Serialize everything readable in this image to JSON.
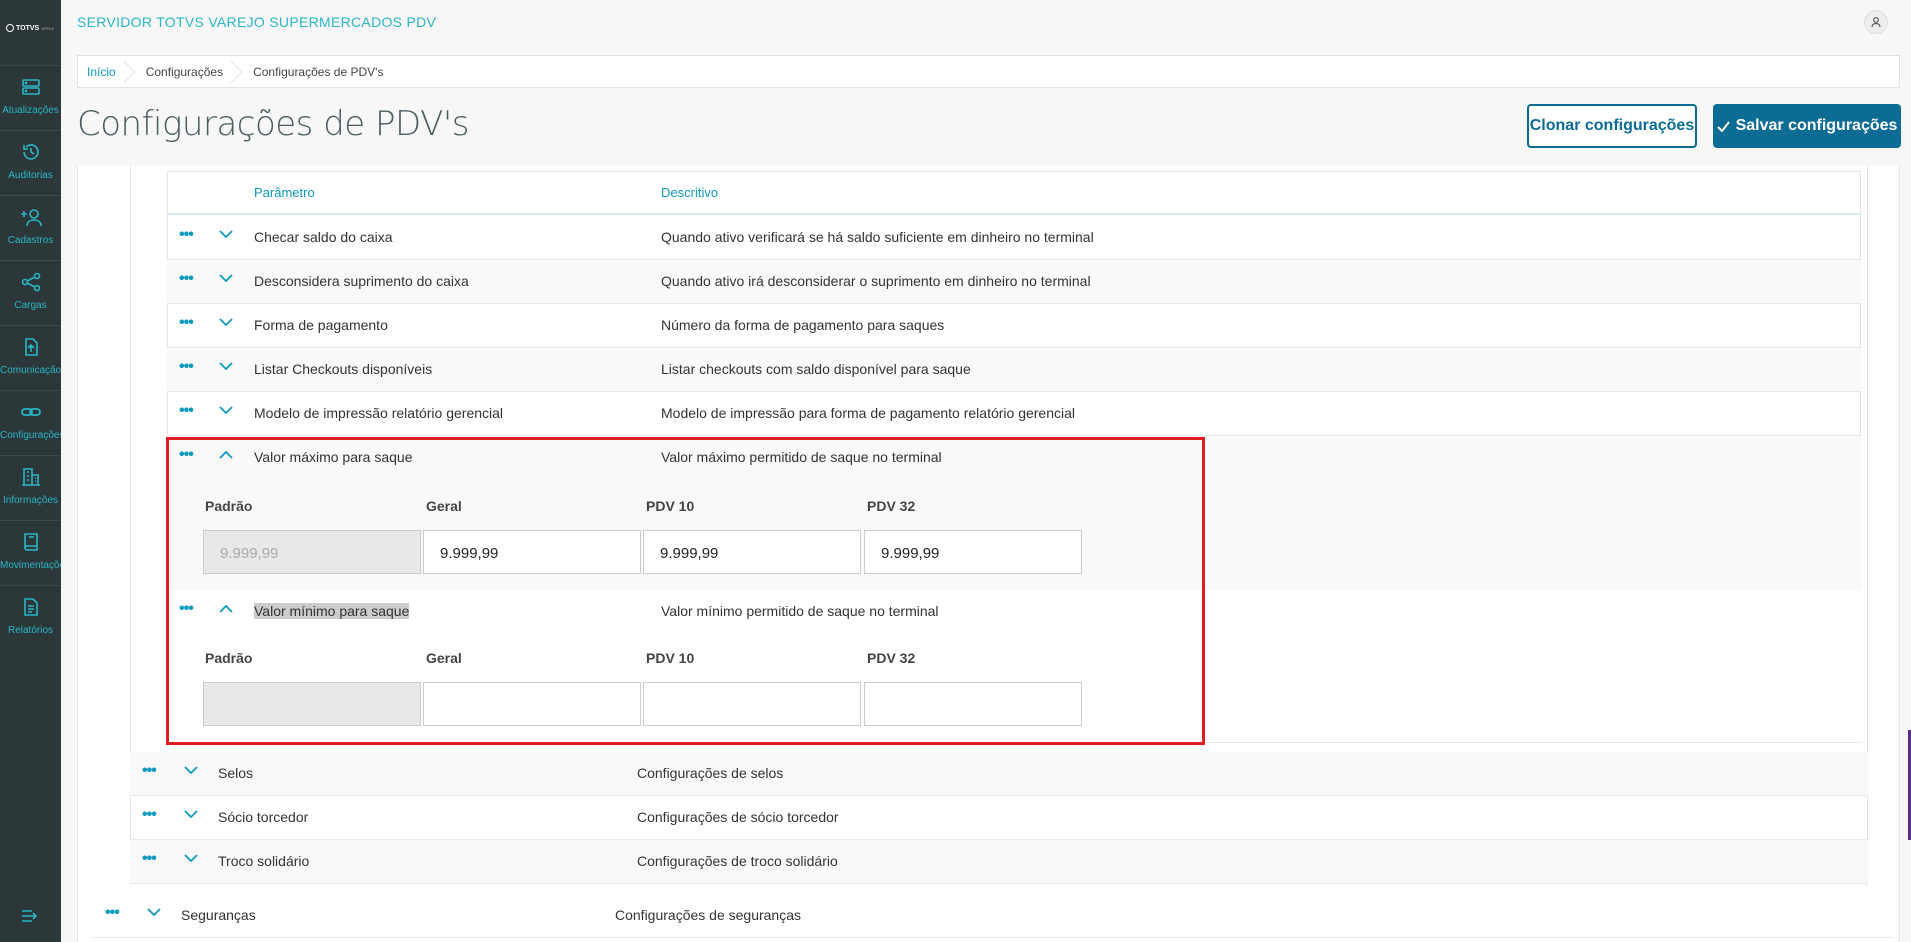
{
  "app": {
    "title": "SERVIDOR TOTVS VAREJO SUPERMERCADOS PDV",
    "logo_text": "TOTVS",
    "logo_sub": "APPLE"
  },
  "sidebar": {
    "items": [
      {
        "label": "Atualizações",
        "icon": "server-icon"
      },
      {
        "label": "Auditorias",
        "icon": "history-icon"
      },
      {
        "label": "Cadastros",
        "icon": "add-user-icon"
      },
      {
        "label": "Cargas",
        "icon": "share-icon"
      },
      {
        "label": "Comunicação",
        "icon": "upload-file-icon"
      },
      {
        "label": "Configurações",
        "icon": "link-icon"
      },
      {
        "label": "Informações",
        "icon": "building-icon"
      },
      {
        "label": "Movimentações",
        "icon": "book-icon"
      },
      {
        "label": "Relatórios",
        "icon": "document-icon"
      }
    ]
  },
  "breadcrumb": [
    "Início",
    "Configurações",
    "Configurações de PDV's"
  ],
  "page": {
    "title": "Configurações de PDV's",
    "clone_label": "Clonar configurações",
    "save_label": "Salvar configurações"
  },
  "table": {
    "headers": {
      "param": "Parâmetro",
      "desc": "Descritivo"
    },
    "rows": [
      {
        "name": "Checar saldo do caixa",
        "desc": "Quando ativo verificará se há saldo suficiente em dinheiro no terminal"
      },
      {
        "name": "Desconsidera suprimento do caixa",
        "desc": "Quando ativo irá desconsiderar o suprimento em dinheiro no terminal"
      },
      {
        "name": "Forma de pagamento",
        "desc": "Número da forma de pagamento para saques"
      },
      {
        "name": "Listar Checkouts disponíveis",
        "desc": "Listar checkouts com saldo disponível para saque"
      },
      {
        "name": "Modelo de impressão relatório gerencial",
        "desc": "Modelo de impressão para forma de pagamento relatório gerencial"
      }
    ],
    "expanded": [
      {
        "name": "Valor máximo para saque",
        "desc": "Valor máximo permitido de saque no terminal",
        "fields": [
          {
            "label": "Padrão",
            "value": "9.999,99"
          },
          {
            "label": "Geral",
            "value": "9.999,99"
          },
          {
            "label": "PDV 10",
            "value": "9.999,99"
          },
          {
            "label": "PDV 32",
            "value": "9.999,99"
          }
        ]
      },
      {
        "name": "Valor mínimo para saque",
        "desc": "Valor mínimo permitido de saque no terminal",
        "fields": [
          {
            "label": "Padrão",
            "value": ""
          },
          {
            "label": "Geral",
            "value": ""
          },
          {
            "label": "PDV 10",
            "value": ""
          },
          {
            "label": "PDV 32",
            "value": ""
          }
        ]
      }
    ],
    "groups": [
      {
        "name": "Selos",
        "desc": "Configurações de selos"
      },
      {
        "name": "Sócio torcedor",
        "desc": "Configurações de sócio torcedor"
      },
      {
        "name": "Troco solidário",
        "desc": "Configurações de troco solidário"
      }
    ],
    "top_group": {
      "name": "Seguranças",
      "desc": "Configurações de seguranças"
    }
  },
  "colors": {
    "accent": "#29b6c5",
    "primary": "#0c6c94",
    "sidebar": "#2c3739",
    "highlight_box": "#e31b23"
  }
}
